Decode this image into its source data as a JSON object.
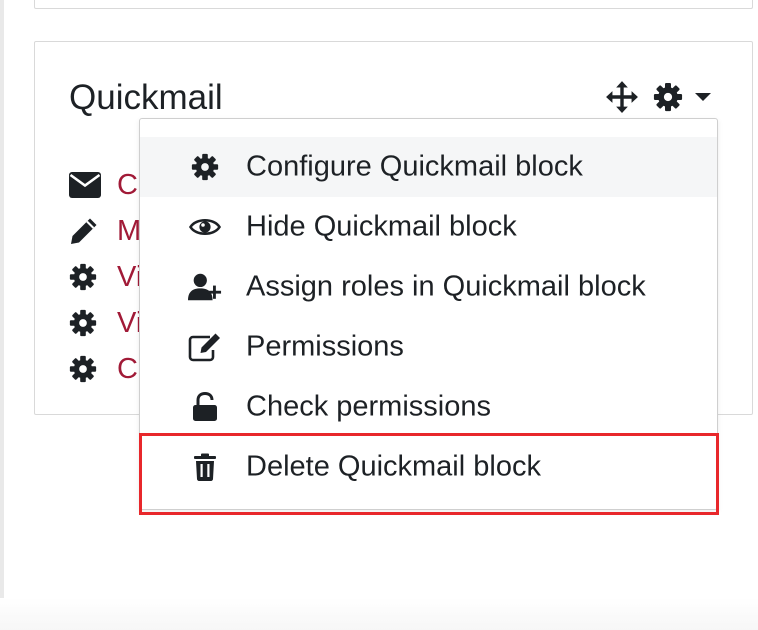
{
  "block": {
    "title": "Quickmail",
    "controls": {
      "move_icon": "move-arrows-icon",
      "actions_icon": "gear-icon",
      "menu_toggle_icon": "caret-down-icon"
    },
    "items": [
      {
        "icon": "envelope-icon",
        "label": "Co"
      },
      {
        "icon": "pencil-icon",
        "label": "M"
      },
      {
        "icon": "gear-icon",
        "label": "Vi"
      },
      {
        "icon": "gear-icon",
        "label": "Vi"
      },
      {
        "icon": "gear-icon",
        "label": "Co"
      }
    ]
  },
  "menu": {
    "items": [
      {
        "icon": "gear-icon",
        "label": "Configure Quickmail block"
      },
      {
        "icon": "eye-icon",
        "label": "Hide Quickmail block"
      },
      {
        "icon": "user-plus-icon",
        "label": "Assign roles in Quickmail block"
      },
      {
        "icon": "edit-icon",
        "label": "Permissions"
      },
      {
        "icon": "unlock-icon",
        "label": "Check permissions"
      },
      {
        "icon": "trash-icon",
        "label": "Delete Quickmail block"
      }
    ]
  },
  "colors": {
    "link": "#a11a37",
    "text": "#1d2125",
    "highlight": "#e8272b",
    "menu_active_bg": "#f5f6f7"
  }
}
